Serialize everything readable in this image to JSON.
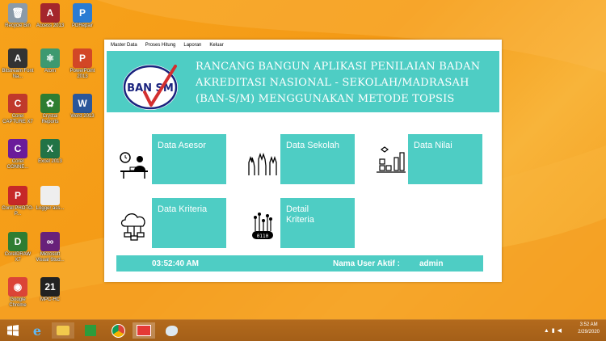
{
  "desktop": {
    "icons": [
      {
        "label": "Recycle Bin",
        "icon": "recycle-bin-icon",
        "color": "#8a9aa8",
        "glyph": "🗑"
      },
      {
        "label": "Access 2013",
        "icon": "access-icon",
        "color": "#a4262c",
        "glyph": "A"
      },
      {
        "label": "PDRepair",
        "icon": "pdrepair-icon",
        "color": "#2b7cd3",
        "glyph": "P"
      },
      {
        "label": "Bitstream Font Na...",
        "icon": "bitstream-icon",
        "color": "#333333",
        "glyph": "A"
      },
      {
        "label": "Atom",
        "icon": "atom-icon",
        "color": "#3d9970",
        "glyph": "⚛"
      },
      {
        "label": "PowerPoint 2013",
        "icon": "powerpoint-icon",
        "color": "#d24726",
        "glyph": "P"
      },
      {
        "label": "Corel CAPTURE X7",
        "icon": "corel-capture-icon",
        "color": "#c0392b",
        "glyph": "C"
      },
      {
        "label": "Crystal Reports",
        "icon": "crystal-reports-icon",
        "color": "#2e7d32",
        "glyph": "✿"
      },
      {
        "label": "Word 2013",
        "icon": "word-icon",
        "color": "#2b579a",
        "glyph": "W"
      },
      {
        "label": "Corel CONNE...",
        "icon": "corel-connect-icon",
        "color": "#6a1b9a",
        "glyph": "C"
      },
      {
        "label": "Excel 2013",
        "icon": "excel-icon",
        "color": "#217346",
        "glyph": "X"
      },
      {
        "label": "Corel PHOTO-P...",
        "icon": "corel-photo-icon",
        "color": "#c62828",
        "glyph": "P"
      },
      {
        "label": "Logger ass...",
        "icon": "file-icon",
        "color": "#eeeeee",
        "glyph": ""
      },
      {
        "label": "CorelDRAW X7",
        "icon": "coreldraw-icon",
        "color": "#2e7d32",
        "glyph": "D"
      },
      {
        "label": "Microsoft Visual Stud...",
        "icon": "visual-studio-icon",
        "color": "#68217a",
        "glyph": "∞"
      },
      {
        "label": "Google Chrome",
        "icon": "chrome-icon",
        "color": "#db4437",
        "glyph": "◉"
      },
      {
        "label": "MPC-HC",
        "icon": "mpc-hc-icon",
        "color": "#222222",
        "glyph": "21"
      }
    ]
  },
  "app": {
    "menu": [
      "Master Data",
      "Proses Hitung",
      "Laporan",
      "Keluar"
    ],
    "header": {
      "logo_text": "BAN SM",
      "title_lines": [
        "RANCANG BANGUN APLIKASI PENILAIAN BADAN",
        "AKREDITASI NASIONAL - SEKOLAH/MADRASAH",
        "(BAN-S/M) MENGGUNAKAN METODE TOPSIS"
      ]
    },
    "tiles": {
      "asesor": "Data Asesor",
      "sekolah": "Data Sekolah",
      "nilai": "Data Nilai",
      "kriteria": "Data Kriteria",
      "detail_line1": "Detail",
      "detail_line2": "Kriteria"
    },
    "status": {
      "time": "03:52:40 AM",
      "user_label": "Nama User Aktif :",
      "user_value": "admin"
    }
  },
  "taskbar": {
    "time": "3:52 AM",
    "date": "2/29/2020"
  }
}
